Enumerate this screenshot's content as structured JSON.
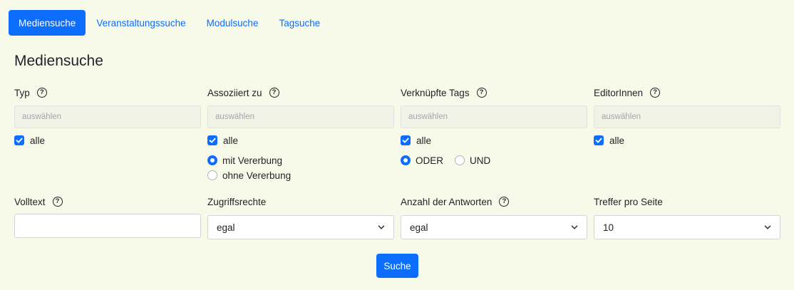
{
  "tabs": [
    {
      "label": "Mediensuche",
      "active": true
    },
    {
      "label": "Veranstaltungssuche",
      "active": false
    },
    {
      "label": "Modulsuche",
      "active": false
    },
    {
      "label": "Tagsuche",
      "active": false
    }
  ],
  "page_title": "Mediensuche",
  "help_glyph": "?",
  "filters": {
    "typ": {
      "label": "Typ",
      "placeholder": "auswählen",
      "all_label": "alle",
      "all_checked": true
    },
    "assoziiert": {
      "label": "Assoziiert zu",
      "placeholder": "auswählen",
      "all_label": "alle",
      "all_checked": true,
      "inherit_options": [
        {
          "label": "mit Vererbung",
          "selected": true
        },
        {
          "label": "ohne Vererbung",
          "selected": false
        }
      ]
    },
    "tags": {
      "label": "Verknüpfte Tags",
      "placeholder": "auswählen",
      "all_label": "alle",
      "all_checked": true,
      "logic_options": [
        {
          "label": "ODER",
          "selected": true
        },
        {
          "label": "UND",
          "selected": false
        }
      ]
    },
    "editoren": {
      "label": "EditorInnen",
      "placeholder": "auswählen",
      "all_label": "alle",
      "all_checked": true
    }
  },
  "row2": {
    "volltext": {
      "label": "Volltext",
      "value": ""
    },
    "zugriffsrechte": {
      "label": "Zugriffsrechte",
      "value": "egal"
    },
    "antworten": {
      "label": "Anzahl der Antworten",
      "value": "egal"
    },
    "treffer": {
      "label": "Treffer pro Seite",
      "value": "10"
    }
  },
  "search_button": "Suche",
  "colors": {
    "accent": "#0d6efd",
    "background": "#f7f9e9"
  }
}
